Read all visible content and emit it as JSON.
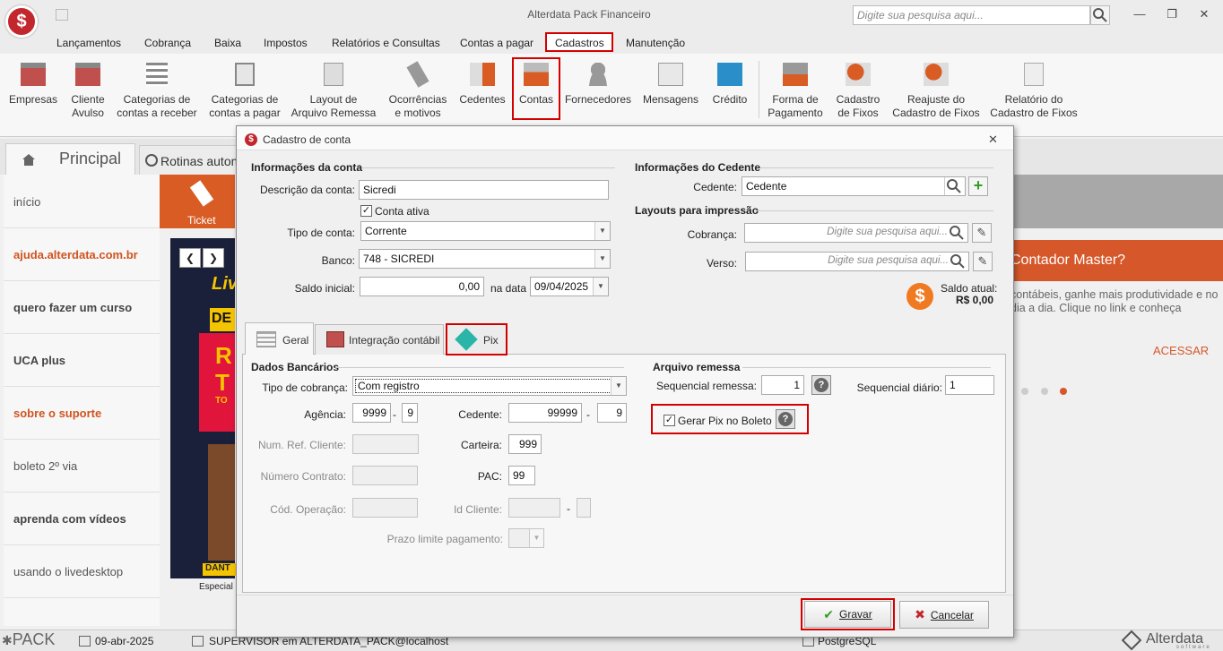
{
  "app": {
    "title": "Alterdata Pack Financeiro",
    "search_placeholder": "Digite sua pesquisa aqui..."
  },
  "menu": [
    "Lançamentos",
    "Cobrança",
    "Baixa",
    "Impostos",
    "Relatórios e Consultas",
    "Contas a pagar",
    "Cadastros",
    "Manutenção"
  ],
  "ribbon": [
    {
      "l1": "Empresas",
      "l2": ""
    },
    {
      "l1": "Cliente",
      "l2": "Avulso"
    },
    {
      "l1": "Categorias de",
      "l2": "contas a receber"
    },
    {
      "l1": "Categorias de",
      "l2": "contas a pagar"
    },
    {
      "l1": "Layout de",
      "l2": "Arquivo Remessa"
    },
    {
      "l1": "Ocorrências",
      "l2": "e motivos"
    },
    {
      "l1": "Cedentes",
      "l2": ""
    },
    {
      "l1": "Contas",
      "l2": ""
    },
    {
      "l1": "Fornecedores",
      "l2": ""
    },
    {
      "l1": "Mensagens",
      "l2": ""
    },
    {
      "l1": "Crédito",
      "l2": ""
    },
    {
      "l1": "Forma de",
      "l2": "Pagamento"
    },
    {
      "l1": "Cadastro",
      "l2": "de Fixos"
    },
    {
      "l1": "Reajuste do",
      "l2": "Cadastro de Fixos"
    },
    {
      "l1": "Relatório do",
      "l2": "Cadastro de Fixos"
    }
  ],
  "background": {
    "tab_principal": "Principal",
    "tab_rotinas": "Rotinas automát",
    "left_items": [
      "início",
      "ajuda.alterdata.com.br",
      "quero fazer um curso",
      "UCA plus",
      "sobre o suporte",
      "boleto 2º via",
      "aprenda com vídeos",
      "usando o livedesktop"
    ],
    "ticket": "Ticket",
    "banner_bottom_1": "DANT",
    "banner_bottom_2": "Especial",
    "banner_text_1": "Liv",
    "banner_text_2": "DE",
    "banner_text_3": "R",
    "banner_text_4": "T",
    "banner_text_5": "TO",
    "contador_title": "Contador Master?",
    "contador_text": "contábeis, ganhe mais produtividade e no dia a dia. Clique no link e conheça",
    "acessar": "ACESSAR"
  },
  "statusbar": {
    "pack": "PACK",
    "date": "09-abr-2025",
    "user": "SUPERVISOR em ALTERDATA_PACK@localhost",
    "db": "PostgreSQL",
    "brand": "Alterdata",
    "brand_sub": "software"
  },
  "dialog": {
    "title": "Cadastro de conta",
    "info_conta": {
      "title": "Informações da conta",
      "descricao_label": "Descrição da conta:",
      "descricao": "Sicredi",
      "conta_ativa_label": "Conta ativa",
      "tipo_label": "Tipo de conta:",
      "tipo": "Corrente",
      "banco_label": "Banco:",
      "banco": "748 - SICREDI",
      "saldo_label": "Saldo inicial:",
      "saldo": "0,00",
      "na_data_label": "na data",
      "data": "09/04/2025"
    },
    "info_cedente": {
      "title": "Informações do Cedente",
      "cedente_label": "Cedente:",
      "cedente": "Cedente",
      "layouts_title": "Layouts para impressão",
      "cobranca_label": "Cobrança:",
      "verso_label": "Verso:",
      "placeholder": "Digite sua pesquisa aqui...",
      "saldo_atual_label": "Saldo atual:",
      "saldo_atual": "R$ 0,00"
    },
    "tabs": [
      "Geral",
      "Integração contábil",
      "Pix"
    ],
    "dados_bancarios": {
      "title": "Dados Bancários",
      "tipo_cobranca_label": "Tipo de cobrança:",
      "tipo_cobranca": "Com registro",
      "agencia_label": "Agência:",
      "agencia": "9999",
      "agencia_dv": "9",
      "cedente_label": "Cedente:",
      "cedente": "99999",
      "cedente_dv": "9",
      "num_ref_label": "Num. Ref. Cliente:",
      "carteira_label": "Carteira:",
      "carteira": "999",
      "numero_contrato_label": "Número Contrato:",
      "pac_label": "PAC:",
      "pac": "99",
      "cod_operacao_label": "Cód. Operação:",
      "id_cliente_label": "Id Cliente:",
      "prazo_label": "Prazo limite pagamento:",
      "dash": "-"
    },
    "arquivo_remessa": {
      "title": "Arquivo remessa",
      "seq_remessa_label": "Sequencial remessa:",
      "seq_remessa": "1",
      "seq_diario_label": "Sequencial diário:",
      "seq_diario": "1",
      "gerar_pix_label": "Gerar Pix no Boleto"
    },
    "buttons": {
      "gravar": "Gravar",
      "cancelar": "Cancelar"
    }
  }
}
